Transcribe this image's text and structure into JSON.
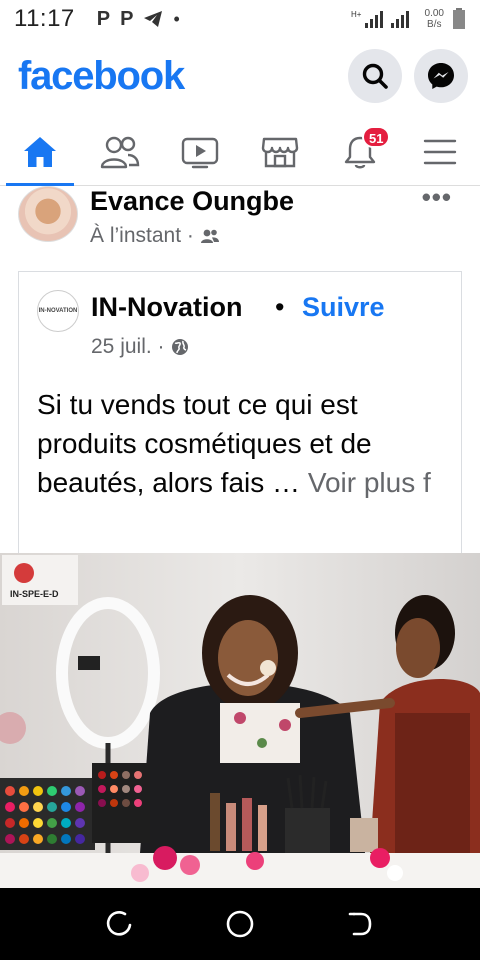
{
  "status_bar": {
    "time": "11:17",
    "notif_p1": "P",
    "notif_p2": "P",
    "notif_dot": "•",
    "network_label": "H+",
    "speed_value": "0.00",
    "speed_unit": "B/s"
  },
  "header": {
    "logo": "facebook",
    "search_icon": "search-icon",
    "messenger_icon": "messenger-icon"
  },
  "nav": {
    "tabs": [
      {
        "icon": "home-icon",
        "active": true
      },
      {
        "icon": "friends-icon",
        "active": false
      },
      {
        "icon": "video-icon",
        "active": false
      },
      {
        "icon": "marketplace-icon",
        "active": false
      },
      {
        "icon": "bell-icon",
        "active": false,
        "badge": "51"
      },
      {
        "icon": "menu-icon",
        "active": false
      }
    ]
  },
  "post": {
    "author": "Evance Oungbe",
    "time": "À l’instant ·",
    "more": "•••",
    "audience_icon": "friends-audience-icon"
  },
  "shared": {
    "page_logo_text": "IN-NOVATION",
    "page_name": "IN-Novation",
    "separator": "•",
    "follow": "Suivre",
    "date": "25 juil. ·",
    "audience_icon": "globe-icon",
    "text": "Si tu vends tout ce qui est produits cosmétiques et de beautés, alors fais … ",
    "see_more": "Voir plus f"
  },
  "photo": {
    "watermark": "IN-SPE-E-D"
  },
  "colors": {
    "brand": "#1877f2",
    "badge": "#e41e3f",
    "secondary_text": "#65676b"
  }
}
